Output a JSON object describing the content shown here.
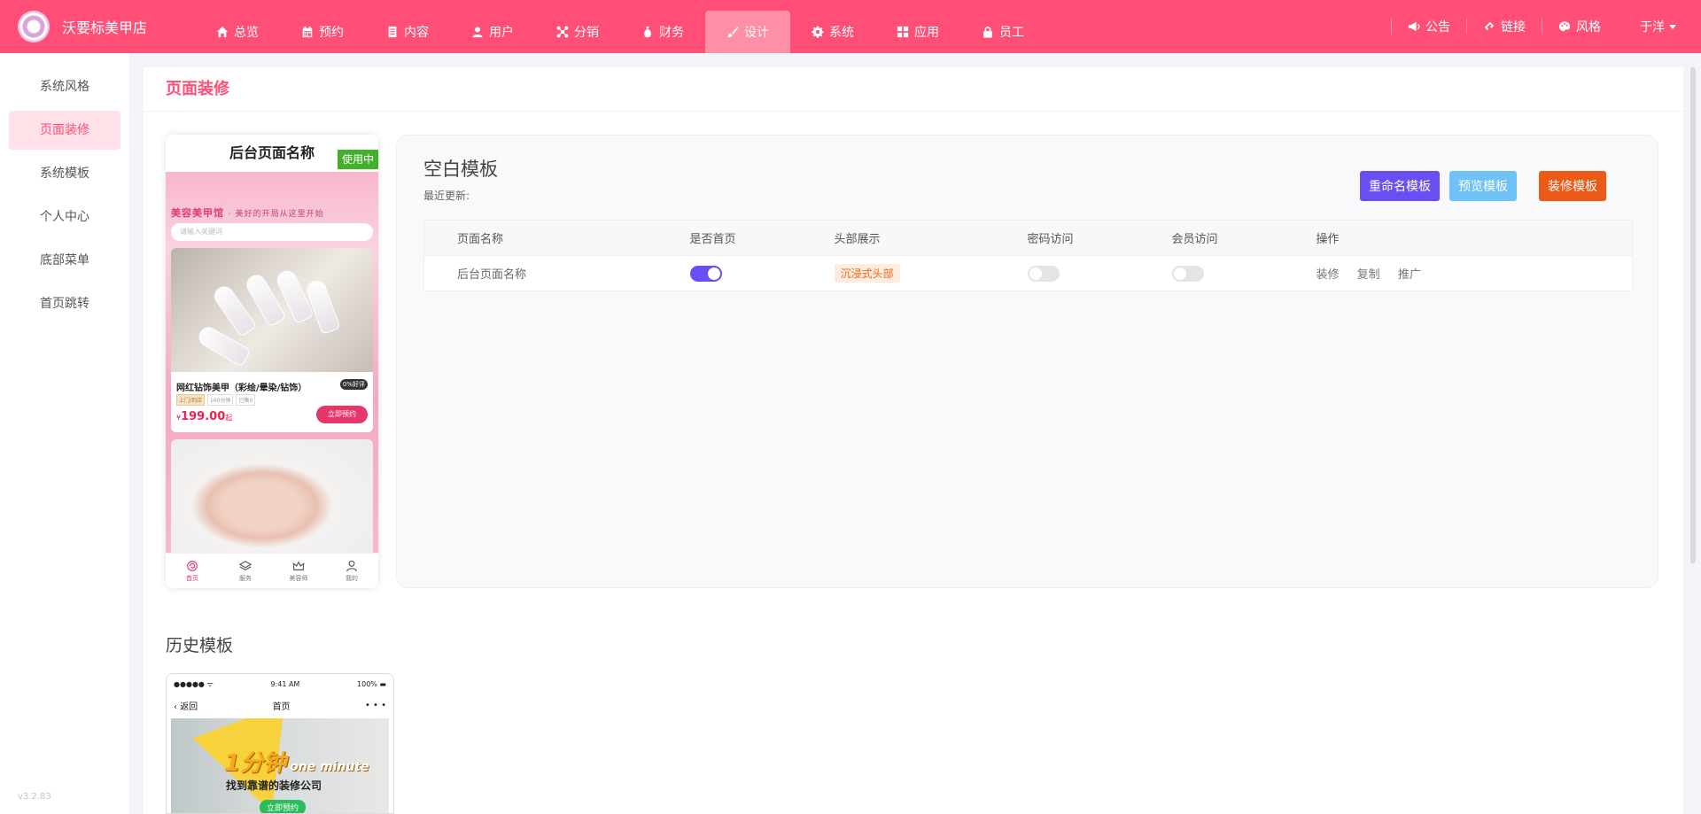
{
  "app": {
    "store_name": "沃要标美甲店",
    "version": "v3.2.83",
    "brand_color": "#ff4f76"
  },
  "nav": [
    {
      "label": "总览",
      "icon": "home-icon",
      "active": false
    },
    {
      "label": "预约",
      "icon": "calendar-icon",
      "active": false
    },
    {
      "label": "内容",
      "icon": "document-icon",
      "active": false
    },
    {
      "label": "用户",
      "icon": "user-icon",
      "active": false
    },
    {
      "label": "分销",
      "icon": "share-icon",
      "active": false
    },
    {
      "label": "财务",
      "icon": "money-bag-icon",
      "active": false
    },
    {
      "label": "设计",
      "icon": "brush-icon",
      "active": true
    },
    {
      "label": "系统",
      "icon": "gear-icon",
      "active": false
    },
    {
      "label": "应用",
      "icon": "grid-icon",
      "active": false
    },
    {
      "label": "员工",
      "icon": "lock-icon",
      "active": false
    }
  ],
  "topright": {
    "announcement": "公告",
    "link": "链接",
    "style": "风格",
    "user": "于洋"
  },
  "sidebar": {
    "items": [
      {
        "label": "系统风格",
        "active": false
      },
      {
        "label": "页面装修",
        "active": true
      },
      {
        "label": "系统模板",
        "active": false
      },
      {
        "label": "个人中心",
        "active": false
      },
      {
        "label": "底部菜单",
        "active": false
      },
      {
        "label": "首页跳转",
        "active": false
      }
    ]
  },
  "page": {
    "title": "页面装修"
  },
  "phone": {
    "title": "后台页面名称",
    "badge": "使用中",
    "banner": "美容美甲馆",
    "banner_sub": "· 美好的开局从这里开始",
    "search_placeholder": "请输入关键词",
    "product": {
      "title": "网红钻饰美甲（彩绘/晕染/钻饰）",
      "rating": "0%好评",
      "tags": [
        "上门/到店",
        "160分钟",
        "已售0"
      ],
      "currency": "¥",
      "price": "199.00",
      "price_unit": "起",
      "button": "立即预约"
    },
    "tabbar": [
      {
        "label": "首页",
        "icon": "home-tab-icon",
        "active": true
      },
      {
        "label": "服务",
        "icon": "layers-tab-icon",
        "active": false
      },
      {
        "label": "美容师",
        "icon": "crown-tab-icon",
        "active": false
      },
      {
        "label": "我的",
        "icon": "person-tab-icon",
        "active": false
      }
    ]
  },
  "template": {
    "title": "空白模板",
    "updated_label": "最近更新:",
    "buttons": {
      "rename": "重命名模板",
      "preview": "预览模板",
      "decorate": "装修模板"
    },
    "columns": [
      "页面名称",
      "是否首页",
      "头部展示",
      "密码访问",
      "会员访问",
      "操作"
    ],
    "rows": [
      {
        "name": "后台页面名称",
        "is_home": true,
        "header": "沉浸式头部",
        "password": false,
        "member": false,
        "actions": [
          "装修",
          "复制",
          "推广"
        ]
      }
    ]
  },
  "history": {
    "title": "历史模板",
    "card": {
      "status_left": "●●●●● ᯤ",
      "time": "9:41 AM",
      "battery": "100%",
      "back": "返回",
      "nav_title": "首页",
      "more": "• • •",
      "banner_big": "1分钟",
      "banner_en": "one minute",
      "banner_sub": "找到靠谱的装修公司",
      "banner_btn": "立即预约"
    }
  }
}
